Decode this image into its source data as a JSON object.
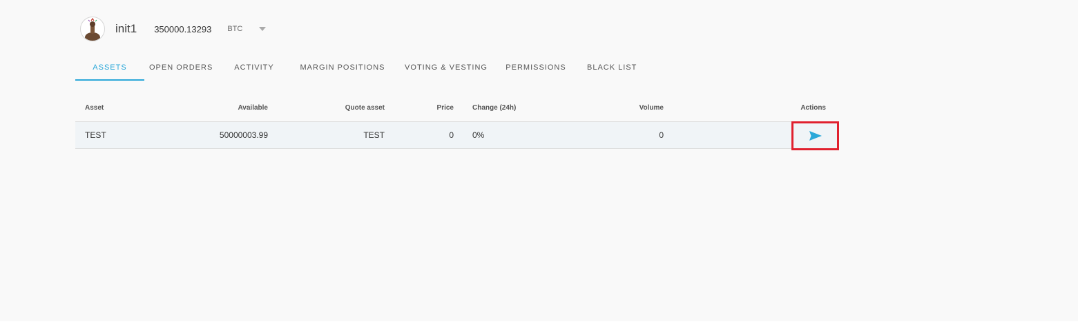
{
  "account": {
    "name": "init1",
    "balance": "350000.13293",
    "currency": "BTC"
  },
  "tabs": [
    {
      "label": "ASSETS",
      "active": true
    },
    {
      "label": "OPEN ORDERS",
      "active": false
    },
    {
      "label": "ACTIVITY",
      "active": false
    },
    {
      "label": "MARGIN POSITIONS",
      "active": false
    },
    {
      "label": "VOTING & VESTING",
      "active": false
    },
    {
      "label": "PERMISSIONS",
      "active": false
    },
    {
      "label": "BLACK LIST",
      "active": false
    }
  ],
  "table": {
    "headers": {
      "asset": "Asset",
      "available": "Available",
      "quote_asset": "Quote asset",
      "price": "Price",
      "change": "Change (24h)",
      "volume": "Volume",
      "actions": "Actions"
    },
    "rows": [
      {
        "asset": "TEST",
        "available": "50000003.99",
        "quote_asset": "TEST",
        "price": "0",
        "change": "0%",
        "volume": "0",
        "action_icon": "send-icon"
      }
    ]
  },
  "colors": {
    "accent": "#2ba8d9",
    "highlight_box": "#e0202e",
    "row_background": "#f0f4f7",
    "page_background": "#f9f9f9"
  }
}
